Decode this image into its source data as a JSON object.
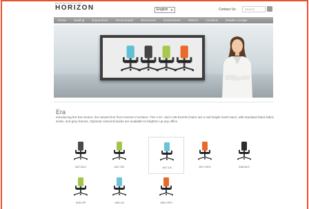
{
  "header": {
    "logo": "HORIZON",
    "language": "English",
    "contact": "Contact Us",
    "search_placeholder": "Search"
  },
  "nav": [
    "Home",
    "Seating",
    "Ergonomics",
    "Environment",
    "Resources",
    "Government",
    "Fabrics",
    "Contacts",
    "Reader Lounge"
  ],
  "hero": {
    "chair_colors": [
      "#5fbfd5",
      "#444444",
      "#a7c84a",
      "#e8692a"
    ]
  },
  "main": {
    "title": "Era",
    "description": "Introducing the Era Series, the newest line from Horizon Furniture. The A-57, and A-58 EraTM chairs are a mid height mesh back, with standard black fabric seats, and grey frames. Optional coloured backs are available to brighten up any office."
  },
  "products": [
    {
      "label": "A57-BLK",
      "color": "#4a4a4a",
      "selected": false
    },
    {
      "label": "A57-GR",
      "color": "#a3c64a",
      "selected": false
    },
    {
      "label": "A57-LB",
      "color": "#6cc3d8",
      "selected": true
    },
    {
      "label": "A57-ORG",
      "color": "#e8692a",
      "selected": false
    },
    {
      "label": "A58-BLK",
      "color": "#2d2d2d",
      "selected": false
    },
    {
      "label": "A58-GR",
      "color": "#a3c64a",
      "selected": false
    },
    {
      "label": "A58-LB",
      "color": "#6cc3d8",
      "selected": false
    },
    {
      "label": "A58-ORG",
      "color": "#e8692a",
      "selected": false
    }
  ]
}
